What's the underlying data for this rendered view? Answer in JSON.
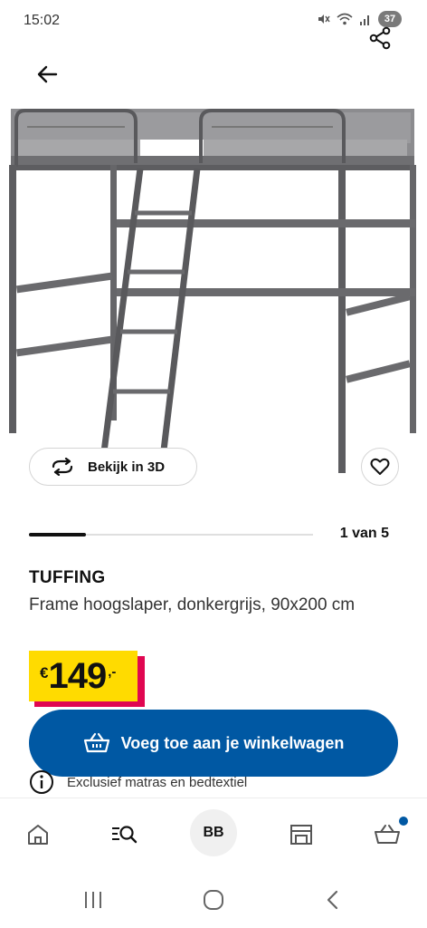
{
  "status_bar": {
    "time": "15:02",
    "battery": "37",
    "icons": [
      "mute-icon",
      "wifi-icon",
      "signal-icon",
      "battery-icon"
    ]
  },
  "header": {
    "back_icon": "arrow-left-icon",
    "share_icon": "share-icon"
  },
  "product_image": {
    "subject": "loft-bed-frame-dark-grey"
  },
  "actions": {
    "view3d_label": "Bekijk in 3D",
    "view3d_icon": "rotate-3d-icon",
    "favorite_icon": "heart-icon"
  },
  "carousel": {
    "counter": "1 van 5",
    "current": 1,
    "total": 5
  },
  "product": {
    "name": "TUFFING",
    "description": "Frame hoogslaper, donkergrijs, 90x200 cm"
  },
  "price": {
    "currency": "€",
    "amount": "149",
    "decimals": ",-"
  },
  "cart": {
    "label": "Voeg toe aan je winkelwagen",
    "icon": "basket-icon"
  },
  "info": {
    "text": "Exclusief matras en bedtextiel",
    "icon": "info-icon"
  },
  "bottom_nav": {
    "items": [
      "home-icon",
      "search-icon",
      "avatar",
      "store-icon",
      "basket-icon"
    ],
    "avatar_initials": "BB"
  },
  "colors": {
    "ikea_blue": "#0058a3",
    "price_yellow": "#ffdb00",
    "price_red": "#e00751"
  }
}
